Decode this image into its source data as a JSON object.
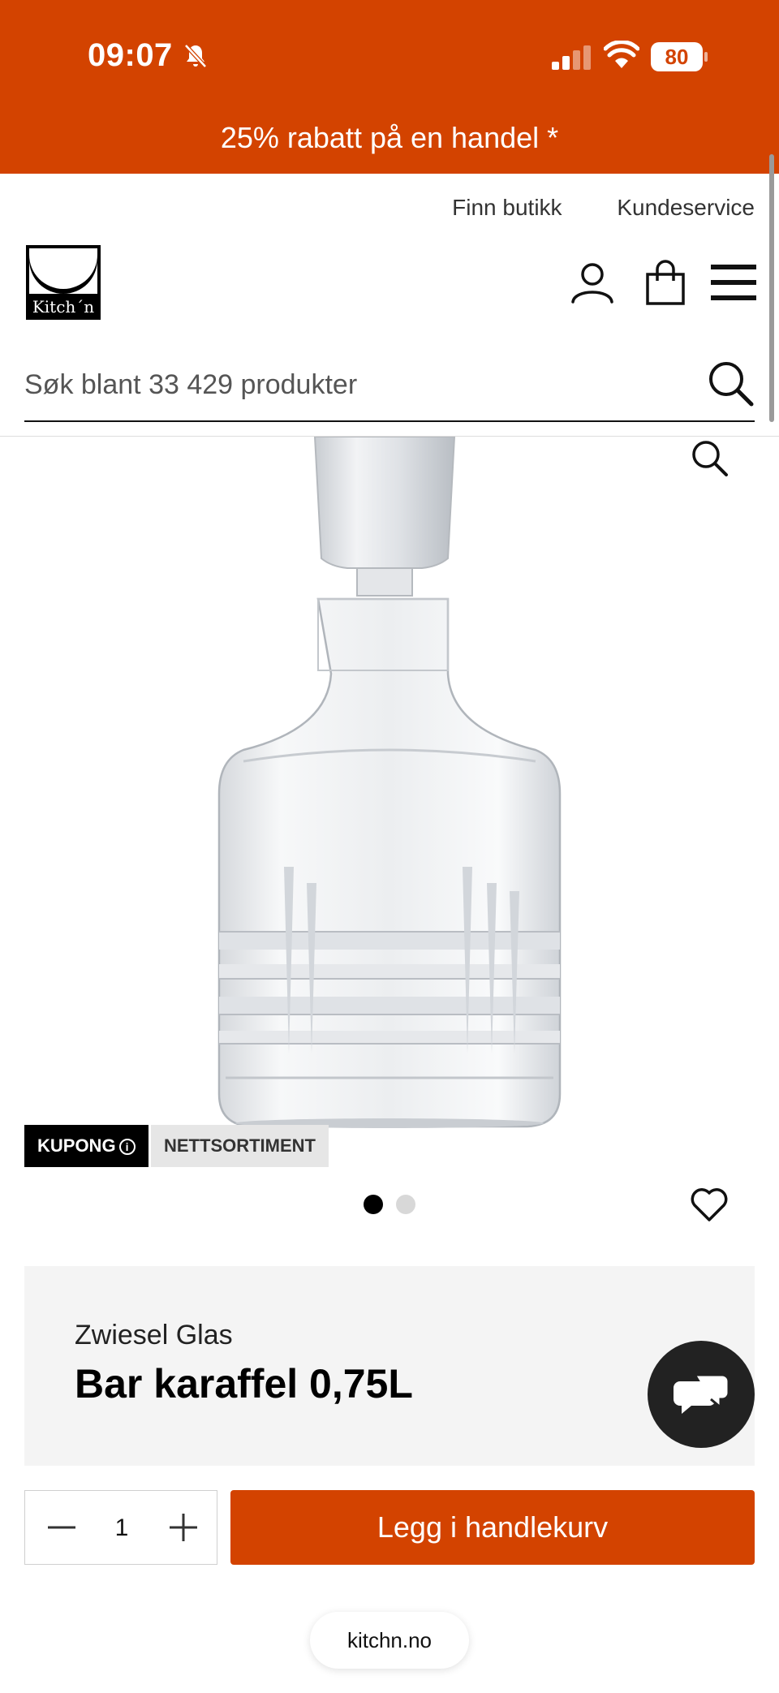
{
  "status_bar": {
    "time": "09:07",
    "battery": "80",
    "icons": [
      "bell-off-icon",
      "signal-icon",
      "wifi-icon",
      "battery-icon"
    ]
  },
  "promo": {
    "text": "25% rabatt på en handel *"
  },
  "top_links": {
    "find_store": "Finn butikk",
    "customer_service": "Kundeservice"
  },
  "logo": {
    "text": "Kitch´n"
  },
  "header_icons": [
    "user-icon",
    "shopping-bag-icon",
    "menu-icon"
  ],
  "search": {
    "placeholder": "Søk blant 33 429 produkter"
  },
  "product": {
    "tags": {
      "coupon": "KUPONG",
      "web_only": "NETTSORTIMENT"
    },
    "brand": "Zwiesel Glas",
    "name": "Bar karaffel 0,75L",
    "image_count": 2,
    "active_image": 1
  },
  "purchase": {
    "quantity": "1",
    "add_to_cart": "Legg i handlekurv"
  },
  "browser": {
    "url": "kitchn.no"
  },
  "colors": {
    "brand": "#d34300",
    "dark": "#222222",
    "panel": "#f4f4f4"
  }
}
